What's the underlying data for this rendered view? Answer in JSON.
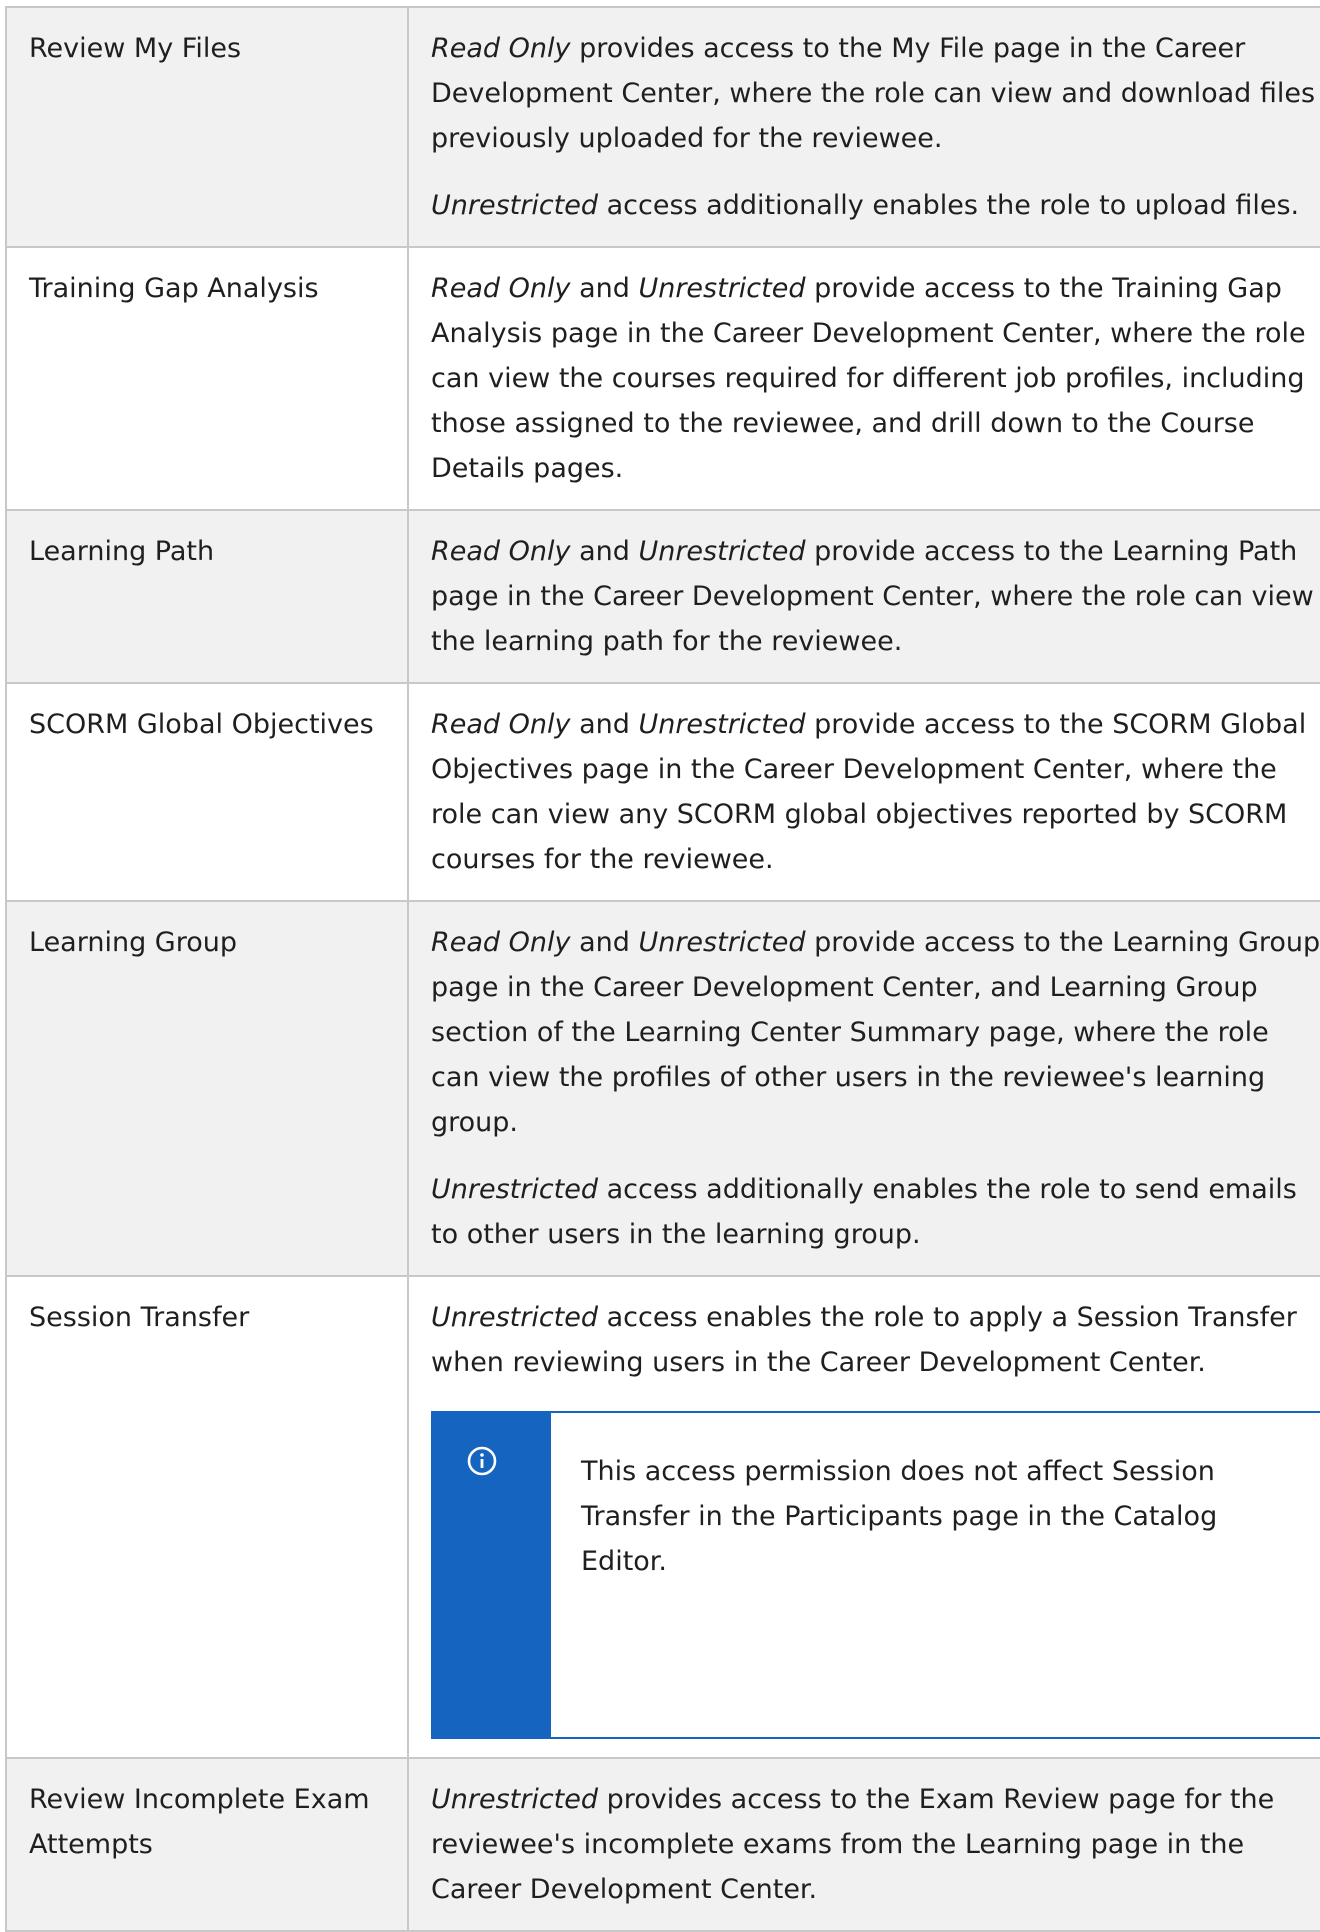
{
  "rows": [
    {
      "name": "Review My Files",
      "shaded": true,
      "paras": [
        [
          {
            "t": "Read Only",
            "i": true
          },
          {
            "t": " provides access to the My File page in the Career Development Center, where the role can view and download files previously uploaded for the reviewee.",
            "i": false
          }
        ],
        [
          {
            "t": "Unrestricted",
            "i": true
          },
          {
            "t": " access additionally enables the role to upload files.",
            "i": false
          }
        ]
      ]
    },
    {
      "name": "Training Gap Analysis",
      "shaded": false,
      "paras": [
        [
          {
            "t": "Read Only",
            "i": true
          },
          {
            "t": " and ",
            "i": false
          },
          {
            "t": "Unrestricted",
            "i": true
          },
          {
            "t": " provide access to the Training Gap Analysis page in the Career Development Center, where the role can view the courses required for different job profiles, including those assigned to the reviewee, and drill down to the Course Details pages.",
            "i": false
          }
        ]
      ]
    },
    {
      "name": "Learning Path",
      "shaded": true,
      "paras": [
        [
          {
            "t": "Read Only",
            "i": true
          },
          {
            "t": " and ",
            "i": false
          },
          {
            "t": "Unrestricted",
            "i": true
          },
          {
            "t": " provide access to the Learning Path page in the Career Development Center, where the role can view the learning path for the reviewee.",
            "i": false
          }
        ]
      ]
    },
    {
      "name": "SCORM Global Objectives",
      "shaded": false,
      "paras": [
        [
          {
            "t": "Read Only",
            "i": true
          },
          {
            "t": " and ",
            "i": false
          },
          {
            "t": "Unrestricted",
            "i": true
          },
          {
            "t": " provide access to the SCORM Global Objectives page in the Career Development Center, where the role can view any SCORM global objectives reported by SCORM courses for the reviewee.",
            "i": false
          }
        ]
      ]
    },
    {
      "name": "Learning Group",
      "shaded": true,
      "paras": [
        [
          {
            "t": "Read Only",
            "i": true
          },
          {
            "t": " and ",
            "i": false
          },
          {
            "t": "Unrestricted",
            "i": true
          },
          {
            "t": " provide access to the Learning Group page in the Career Development Center, and Learning Group section of the Learning Center Summary page, where the role can view the profiles of other users in the reviewee's learning group.",
            "i": false
          }
        ],
        [
          {
            "t": "Unrestricted",
            "i": true
          },
          {
            "t": " access additionally enables the role to send emails to other users in the learning group.",
            "i": false
          }
        ]
      ]
    },
    {
      "name": "Session Transfer",
      "shaded": false,
      "paras": [
        [
          {
            "t": "Unrestricted",
            "i": true
          },
          {
            "t": " access enables the role to apply a Session Transfer when reviewing users in the Career Development Center.",
            "i": false
          }
        ]
      ],
      "note": {
        "icon": "info-icon",
        "text": "This access permission does not affect Session Transfer in the Participants page in the Catalog Editor."
      }
    },
    {
      "name": "Review Incomplete Exam Attempts",
      "shaded": true,
      "paras": [
        [
          {
            "t": "Unrestricted",
            "i": true
          },
          {
            "t": " provides access to the Exam Review page for the reviewee's incomplete exams from the Learning page in the Career Development Center.",
            "i": false
          }
        ]
      ]
    }
  ],
  "colors": {
    "shade": "#f1f1f1",
    "border": "#c8c8c8",
    "note_accent": "#1565c0"
  }
}
